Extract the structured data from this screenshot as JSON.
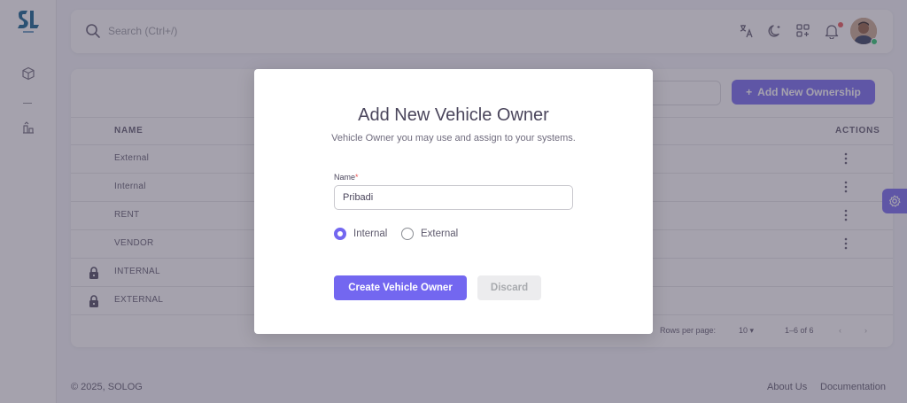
{
  "header": {
    "search_placeholder": "Search (Ctrl+/)"
  },
  "icons": {
    "logo": "solog-logo-icon",
    "sidebar": [
      "cube-icon",
      "gallery-icon"
    ],
    "navbar": [
      "translate-icon",
      "moon-icon",
      "shortcuts-icon",
      "bell-icon"
    ]
  },
  "card": {
    "add_button_label": "Add New Ownership",
    "columns": [
      "NAME",
      "ACTIONS"
    ],
    "rows": [
      {
        "name": "External",
        "locked": false
      },
      {
        "name": "Internal",
        "locked": false
      },
      {
        "name": "RENT",
        "locked": false
      },
      {
        "name": "VENDOR",
        "locked": false
      },
      {
        "name": "INTERNAL",
        "locked": true
      },
      {
        "name": "EXTERNAL",
        "locked": true
      }
    ],
    "pagination": {
      "rows_per_page_label": "Rows per page:",
      "rows_per_page_value": "10",
      "range": "1–6 of 6"
    }
  },
  "footer": {
    "copyright": "© 2025, SOLOG",
    "links": [
      "About Us",
      "Documentation"
    ]
  },
  "modal": {
    "title": "Add New Vehicle Owner",
    "subtitle": "Vehicle Owner you may use and assign to your systems.",
    "name_label": "Name",
    "name_required_mark": "*",
    "name_value": "Pribadi",
    "radio_options": [
      {
        "label": "Internal",
        "checked": true
      },
      {
        "label": "External",
        "checked": false
      }
    ],
    "submit_label": "Create Vehicle Owner",
    "discard_label": "Discard"
  },
  "colors": {
    "primary": "#7367f0",
    "success": "#28c76f",
    "danger": "#ea5455"
  }
}
